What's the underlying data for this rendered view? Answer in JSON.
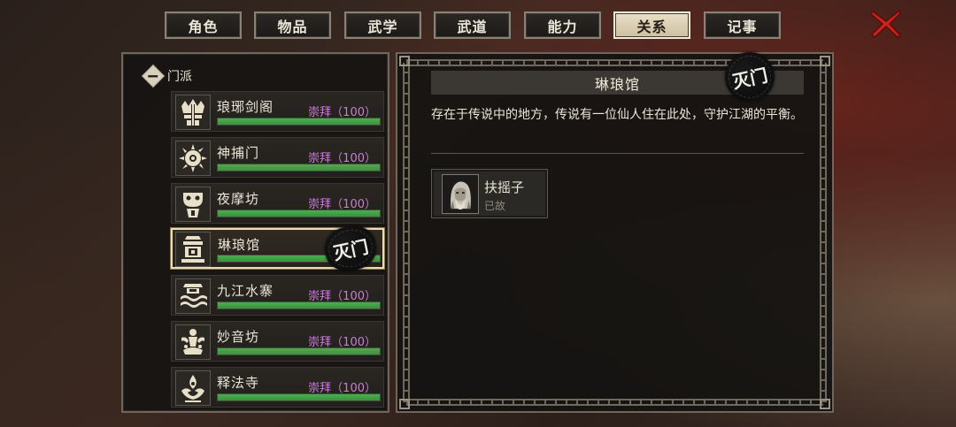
{
  "tabs": [
    {
      "label": "角色",
      "active": false
    },
    {
      "label": "物品",
      "active": false
    },
    {
      "label": "武学",
      "active": false
    },
    {
      "label": "武道",
      "active": false
    },
    {
      "label": "能力",
      "active": false
    },
    {
      "label": "关系",
      "active": true
    },
    {
      "label": "记事",
      "active": false
    }
  ],
  "close_icon": "close-x-icon",
  "sidebar": {
    "category_label": "门派",
    "sects": [
      {
        "name": "琅琊剑阁",
        "relation": "崇拜（100）",
        "progress": 1.0,
        "icon": "crown-crest-icon",
        "selected": false
      },
      {
        "name": "神捕门",
        "relation": "崇拜（100）",
        "progress": 1.0,
        "icon": "sun-eye-crest-icon",
        "selected": false
      },
      {
        "name": "夜摩坊",
        "relation": "崇拜（100）",
        "progress": 1.0,
        "icon": "mask-crest-icon",
        "selected": false
      },
      {
        "name": "琳琅馆",
        "relation": "",
        "progress": 1.0,
        "icon": "treasure-crest-icon",
        "selected": true,
        "stamp": "灭门"
      },
      {
        "name": "九江水寨",
        "relation": "崇拜（100）",
        "progress": 1.0,
        "icon": "wave-crest-icon",
        "selected": false
      },
      {
        "name": "妙音坊",
        "relation": "崇拜（100）",
        "progress": 1.0,
        "icon": "lotus-dancer-crest-icon",
        "selected": false
      },
      {
        "name": "释法寺",
        "relation": "崇拜（100）",
        "progress": 1.0,
        "icon": "flame-lotus-crest-icon",
        "selected": false
      }
    ]
  },
  "detail": {
    "title": "琳琅馆",
    "stamp": "灭门",
    "description": "存在于传说中的地方，传说有一位仙人住在此处，守护江湖的平衡。",
    "members": [
      {
        "name": "扶摇子",
        "status": "已故",
        "portrait": "elder-portrait-icon"
      }
    ]
  },
  "colors": {
    "relation_text": "#c97dd9",
    "bar_green": "#4cae4e",
    "active_tab": "#e9dfc9",
    "close_red": "#c8231d"
  }
}
